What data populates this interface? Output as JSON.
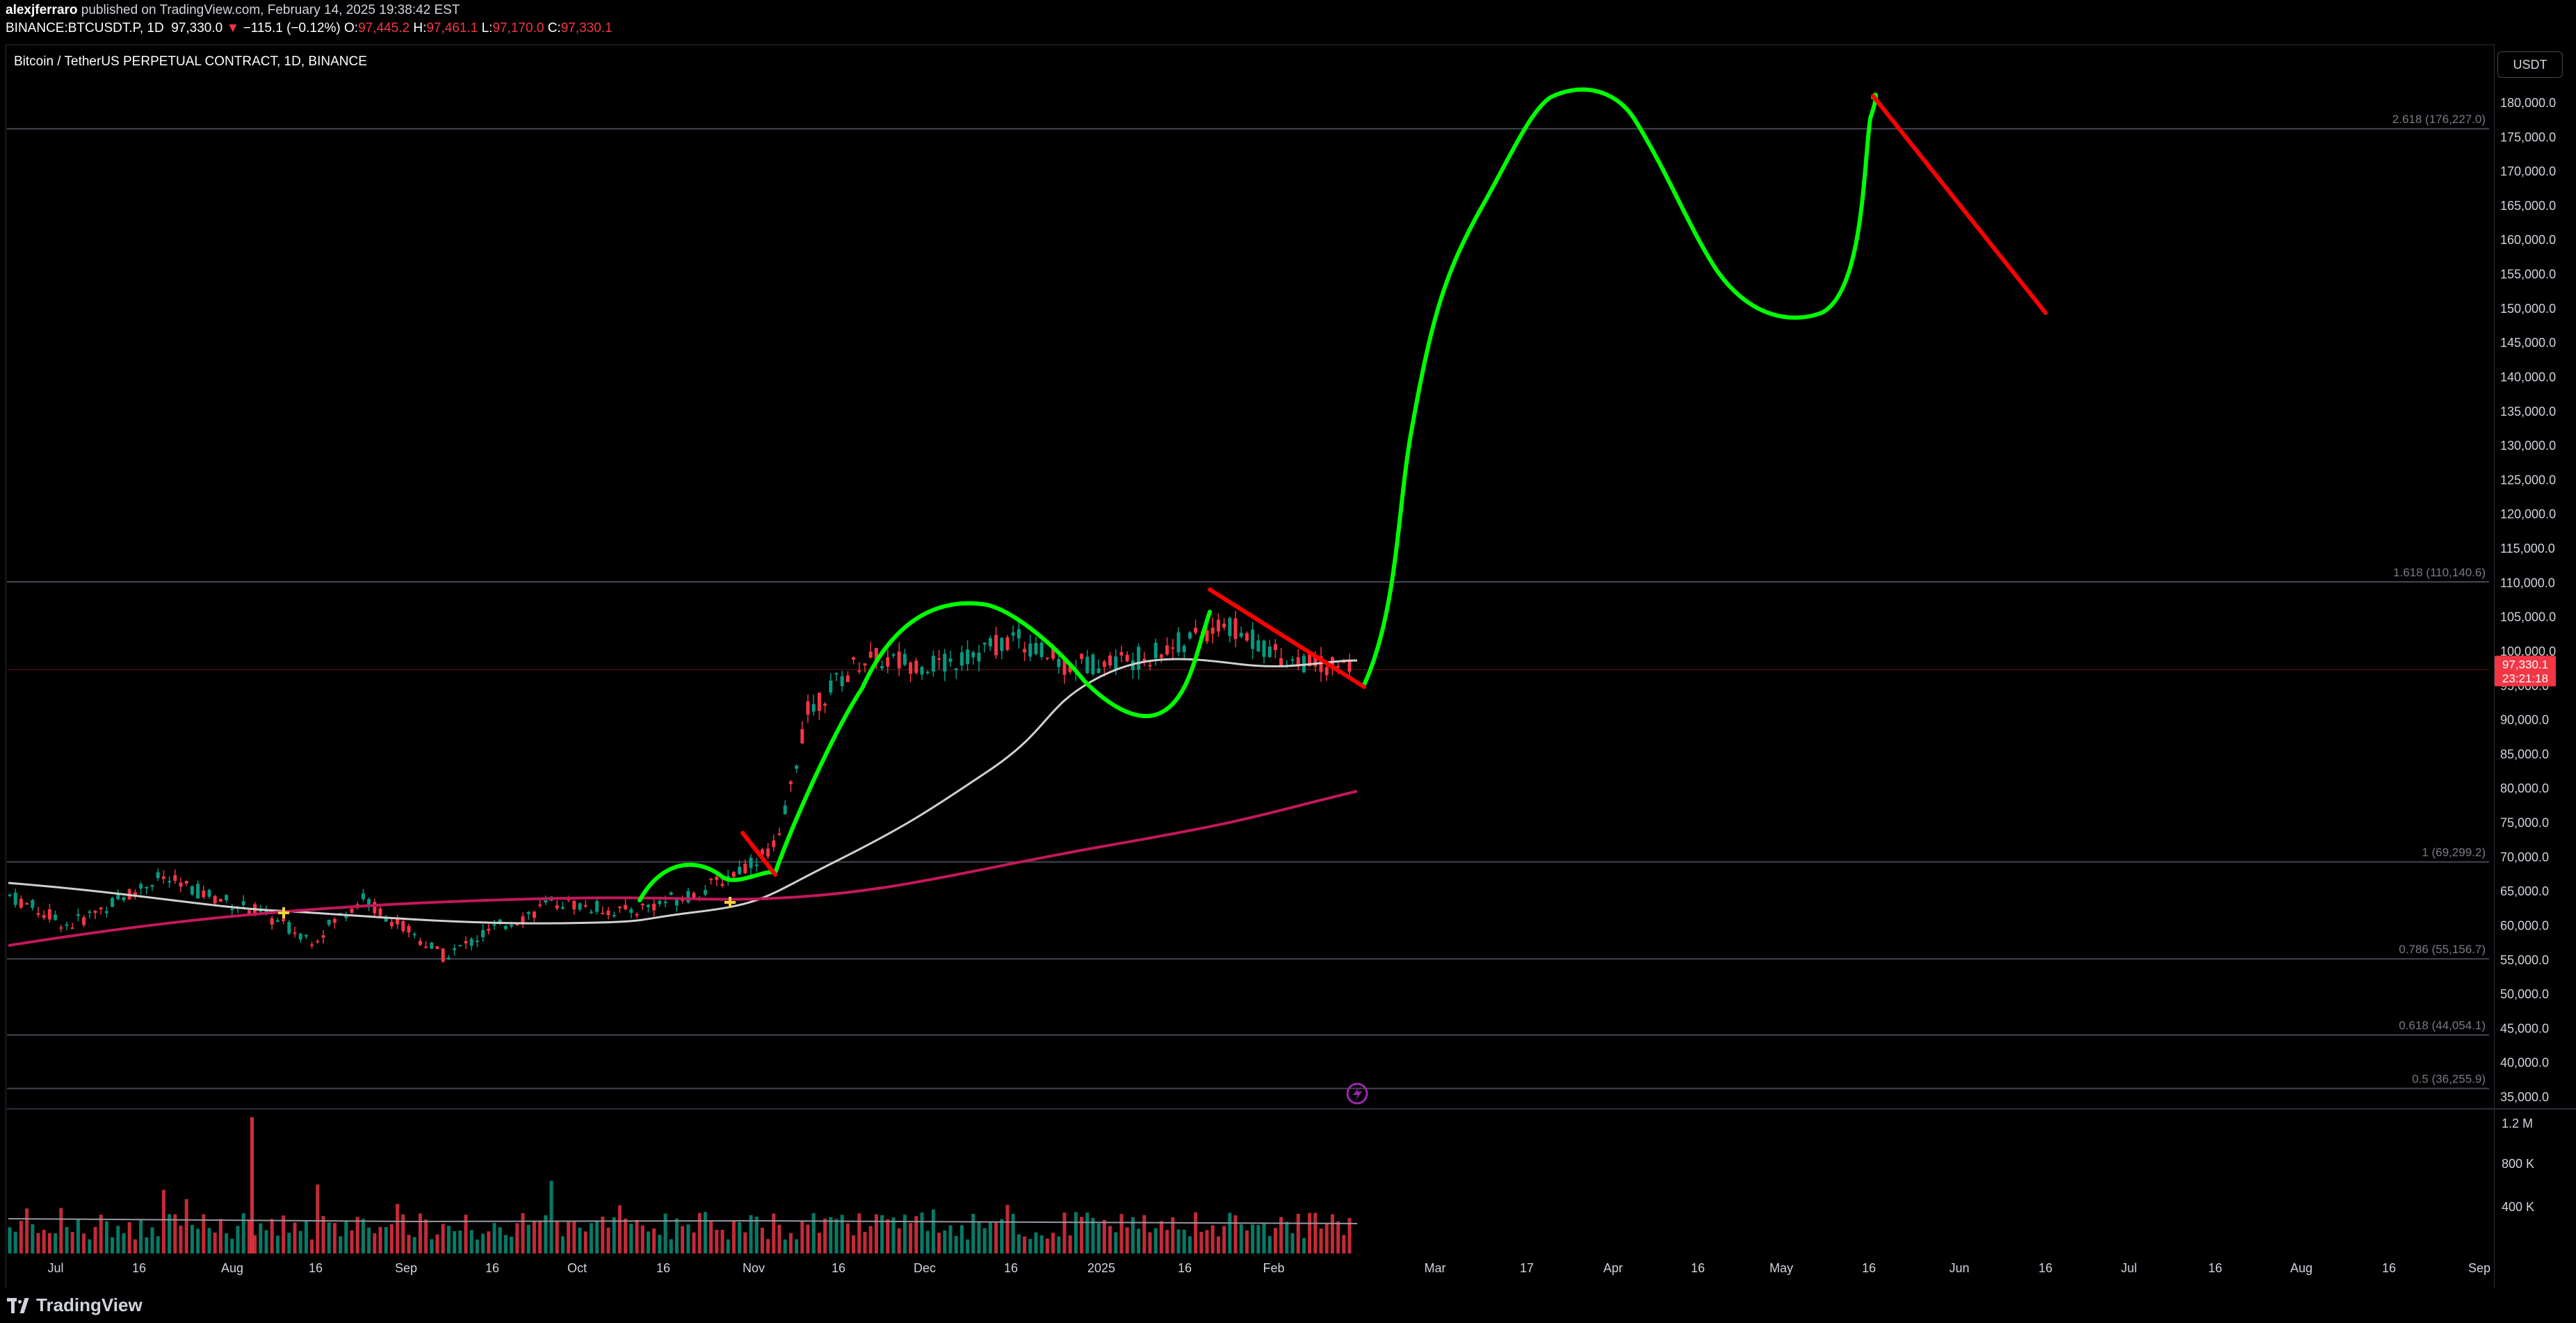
{
  "header": {
    "author": "alexjferraro",
    "published_text": " published on TradingView.com, February 14, 2025 19:38:42 EST",
    "symbol": "BINANCE:BTCUSDT.P, 1D",
    "last": "97,330.0",
    "change_arrow": "▼",
    "change": "−115.1 (−0.12%)",
    "o_label": "O:",
    "o": "97,445.2",
    "h_label": "H:",
    "h": "97,461.1",
    "l_label": "L:",
    "l": "97,170.0",
    "c_label": "C:",
    "c": "97,330.1"
  },
  "chart_title": "Bitcoin / TetherUS PERPETUAL CONTRACT, 1D, BINANCE",
  "currency_button": "USDT",
  "price_axis": {
    "ticks": [
      "180,000.0",
      "175,000.0",
      "170,000.0",
      "165,000.0",
      "160,000.0",
      "155,000.0",
      "150,000.0",
      "145,000.0",
      "140,000.0",
      "135,000.0",
      "130,000.0",
      "125,000.0",
      "120,000.0",
      "115,000.0",
      "110,000.0",
      "105,000.0",
      "100,000.0",
      "95,000.0",
      "90,000.0",
      "85,000.0",
      "80,000.0",
      "75,000.0",
      "70,000.0",
      "65,000.0",
      "60,000.0",
      "55,000.0",
      "50,000.0",
      "45,000.0",
      "40,000.0",
      "35,000.0"
    ],
    "last_price_badge": "97,330.1",
    "countdown_badge": "23:21:18"
  },
  "volume_axis": {
    "ticks": [
      "1.2 M",
      "800 K",
      "400 K"
    ]
  },
  "time_axis": {
    "ticks": [
      "Jul",
      "16",
      "Aug",
      "16",
      "Sep",
      "16",
      "Oct",
      "16",
      "Nov",
      "16",
      "Dec",
      "16",
      "2025",
      "16",
      "Feb",
      "Mar",
      "17",
      "Apr",
      "16",
      "May",
      "16",
      "Jun",
      "16",
      "Jul",
      "16",
      "Aug",
      "16",
      "Sep"
    ]
  },
  "fib_levels": [
    {
      "label": "2.618 (176,227.0)",
      "value": 176227.0
    },
    {
      "label": "1.618 (110,140.6)",
      "value": 110140.6
    },
    {
      "label": "1 (69,299.2)",
      "value": 69299.2
    },
    {
      "label": "0.786 (55,156.7)",
      "value": 55156.7
    },
    {
      "label": "0.618 (44,054.1)",
      "value": 44054.1
    },
    {
      "label": "0.5 (36,255.9)",
      "value": 36255.9
    }
  ],
  "colors": {
    "up": "#089981",
    "down": "#f23645",
    "projection": "#00ff00",
    "trend": "#ff0000",
    "ma_fast": "#d0d0d0",
    "ma_slow": "#c2185b",
    "fib": "#434651",
    "badge": "#f23645",
    "event": "#9c27b0"
  },
  "event_icon": "lightning-icon",
  "footer": {
    "brand": "TradingView"
  }
}
